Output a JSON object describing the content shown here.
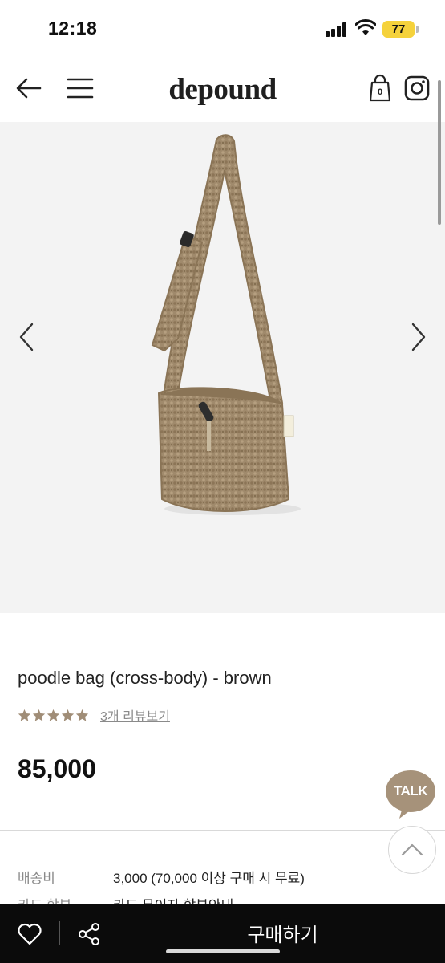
{
  "status_bar": {
    "time": "12:18",
    "battery": "77"
  },
  "header": {
    "logo": "depound",
    "cart_count": "0"
  },
  "product": {
    "name": "poodle bag (cross-body) - brown",
    "rating_stars": 5,
    "review_link": "3개 리뷰보기",
    "price": "85,000"
  },
  "floating": {
    "talk_label": "TALK"
  },
  "info": {
    "shipping_label": "배송비",
    "shipping_value": "3,000 (70,000 이상 구매 시 무료)",
    "card_label": "카드 할부",
    "card_value": "카드 무이자 할부안내"
  },
  "bottom_bar": {
    "buy_label": "구매하기"
  },
  "colors": {
    "accent_bag": "#9b8466",
    "star": "#a08d77",
    "talk_bubble": "#a6927a"
  }
}
